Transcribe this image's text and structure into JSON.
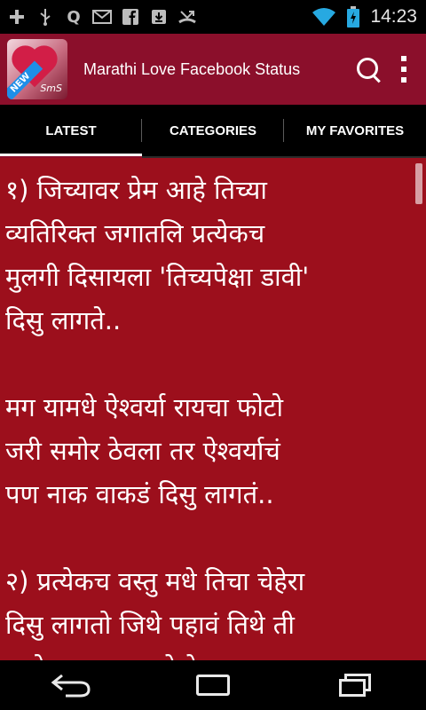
{
  "status_bar": {
    "time": "14:23",
    "icons": [
      "add-icon",
      "usb-icon",
      "q-notification-icon",
      "gmail-icon",
      "facebook-icon",
      "download-icon",
      "missed-call-icon",
      "wifi-icon",
      "battery-charging-icon"
    ]
  },
  "app_bar": {
    "title": "Marathi Love Facebook Status",
    "logo_badge": "NEW",
    "logo_text": "SmS",
    "actions": [
      "search-icon",
      "overflow-menu-icon"
    ],
    "color": "#8b0f2b"
  },
  "tabs": [
    {
      "label": "LATEST",
      "active": true
    },
    {
      "label": "CATEGORIES",
      "active": false
    },
    {
      "label": "MY FAVORITES",
      "active": false
    }
  ],
  "content": {
    "background": "#9c0f1c",
    "status_text": "१) जिच्यावर प्रेम आहे तिच्या\nव्यतिरिक्त जगातलि प्रत्येकच\nमुलगी दिसायला 'तिच्यपेक्षा डावी'\nदिसु लागते..\n\nमग यामधे ऐश्वर्या रायचा फोटो\nजरी समोर ठेवला तर ऐश्वर्याचं\nपण नाक वाकडं दिसु लागतं..\n\n२) प्रत्येकच वस्तु मधे तिचा चेहेरा\nदिसु लागतो जिथे पहावं तिथे ती\nआहे असा भास होतो.."
  },
  "nav_bar": {
    "buttons": [
      "back-icon",
      "home-icon",
      "recents-icon"
    ]
  }
}
